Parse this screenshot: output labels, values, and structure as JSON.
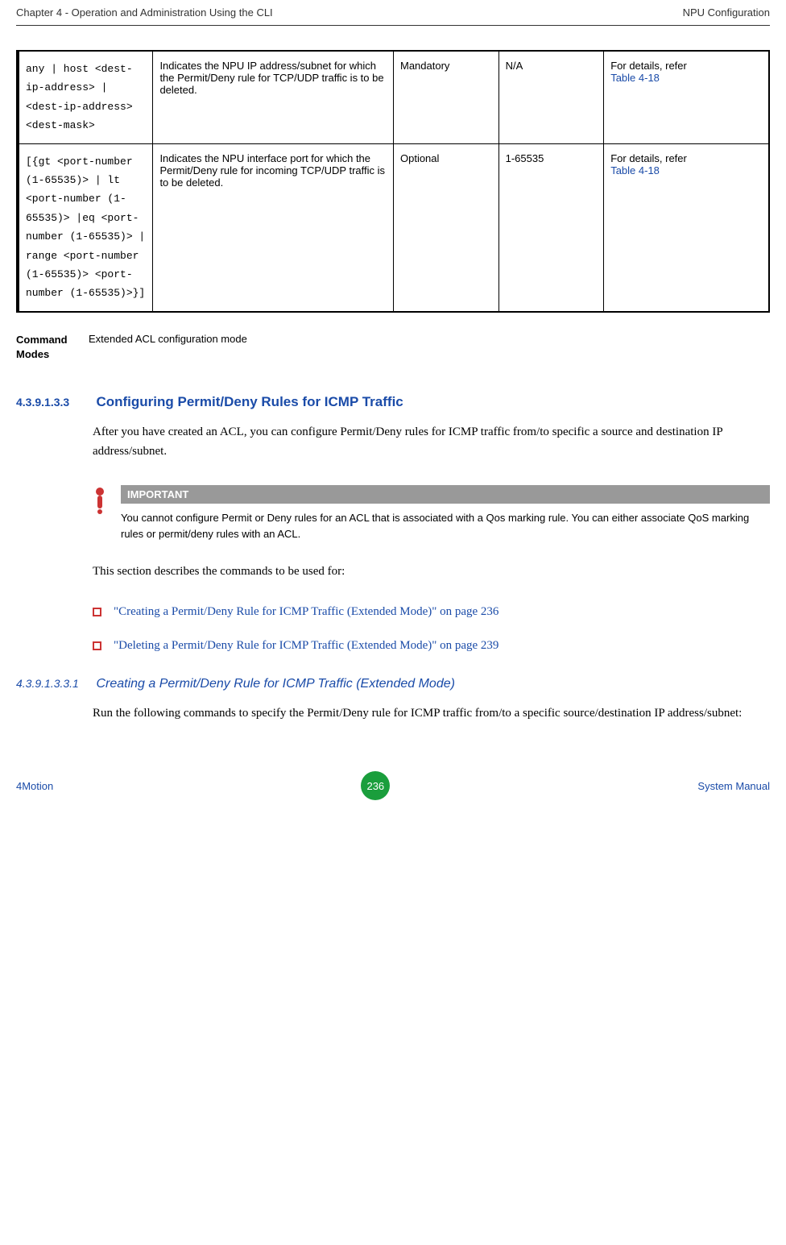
{
  "header": {
    "left": "Chapter 4 - Operation and Administration Using the CLI",
    "right": "NPU Configuration"
  },
  "table": {
    "rows": [
      {
        "param": "any | host <dest-ip-address> | <dest-ip-address> <dest-mask>",
        "description": "Indicates the NPU IP address/subnet for which the Permit/Deny rule for TCP/UDP traffic is to be deleted.",
        "presence": "Mandatory",
        "range": "N/A",
        "details_prefix": "For details, refer",
        "details_link": "Table 4-18"
      },
      {
        "param": "[{gt <port-number (1-65535)> | lt <port-number (1-65535)> |eq <port-number (1-65535)> | range <port-number (1-65535)> <port-number (1-65535)>}]",
        "description": "Indicates the NPU interface port for which the Permit/Deny rule for incoming TCP/UDP traffic is to be deleted.",
        "presence": "Optional",
        "range": "1-65535",
        "details_prefix": "For details, refer",
        "details_link": "Table 4-18"
      }
    ]
  },
  "command_modes": {
    "label": "Command Modes",
    "value": "Extended ACL configuration mode"
  },
  "section": {
    "number": "4.3.9.1.3.3",
    "title": "Configuring Permit/Deny Rules for ICMP Traffic",
    "body1": "After you have created an ACL, you can configure Permit/Deny rules for ICMP traffic from/to specific a source and destination IP address/subnet.",
    "body2": "This section describes the commands to be used for:"
  },
  "important": {
    "header": "IMPORTANT",
    "text": "You cannot configure Permit or Deny rules for an ACL that is associated with a Qos marking rule. You can either associate QoS marking rules or permit/deny rules with an ACL."
  },
  "bullets": [
    "\"Creating a Permit/Deny Rule for ICMP Traffic (Extended Mode)\" on page 236",
    "\"Deleting a Permit/Deny Rule for ICMP Traffic (Extended Mode)\" on page 239"
  ],
  "subsection": {
    "number": "4.3.9.1.3.3.1",
    "title": "Creating a Permit/Deny Rule for ICMP Traffic (Extended Mode)",
    "body": "Run the following commands to specify the Permit/Deny rule for ICMP traffic from/to a specific source/destination IP address/subnet:"
  },
  "footer": {
    "left": "4Motion",
    "page": "236",
    "right": "System Manual"
  }
}
